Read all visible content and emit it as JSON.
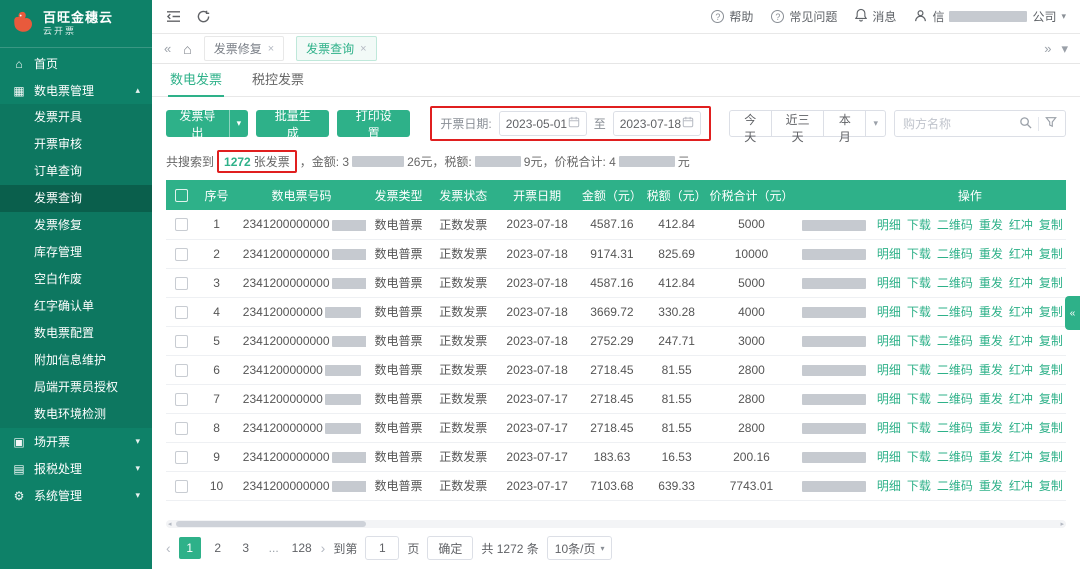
{
  "colors": {
    "sidebar": "#0e8168",
    "accent": "#2eb189",
    "annotation": "#e01f1f"
  },
  "icons": {
    "home": "⌂",
    "close": "×",
    "caret_down": "▾",
    "caret_up": "▴",
    "tabs_left": "«",
    "tabs_right": "»",
    "prev": "‹",
    "next": "›",
    "collapse": "«",
    "scroll_left": "◂",
    "scroll_right": "▸",
    "home-icon": "⌂",
    "invoice-manage-icon": "▦",
    "scene-invoice-icon": "▣",
    "tax-report-icon": "▤",
    "system-manage-icon": "⚙"
  },
  "brand": {
    "title": "百旺金穗云",
    "subtitle": "云开票"
  },
  "topbar": {
    "help": "帮助",
    "faq": "常见问题",
    "messages": "消息",
    "account_prefix": "信",
    "account_suffix": "公司"
  },
  "tabbar": {
    "tabs": [
      {
        "label": "发票修复",
        "active": false
      },
      {
        "label": "发票查询",
        "active": true
      }
    ]
  },
  "sidebar": {
    "items": [
      {
        "label": "首页",
        "icon": "home-icon",
        "children": null,
        "expanded": false
      },
      {
        "label": "数电票管理",
        "icon": "invoice-manage-icon",
        "expanded": true,
        "children": [
          "发票开具",
          "开票审核",
          "订单查询",
          "发票查询",
          "发票修复",
          "库存管理",
          "空白作废",
          "红字确认单",
          "数电票配置",
          "附加信息维护",
          "局端开票员授权",
          "数电环境检测"
        ]
      },
      {
        "label": "场开票",
        "icon": "scene-invoice-icon",
        "expanded": false,
        "children": []
      },
      {
        "label": "报税处理",
        "icon": "tax-report-icon",
        "expanded": false,
        "children": []
      },
      {
        "label": "系统管理",
        "icon": "system-manage-icon",
        "expanded": false,
        "children": []
      }
    ],
    "active_item": "发票查询"
  },
  "content": {
    "tabs": [
      {
        "label": "数电发票",
        "active": true
      },
      {
        "label": "税控发票",
        "active": false
      }
    ],
    "toolbar": {
      "export_button": "发票导出",
      "batch_button": "批量生成",
      "print_button": "打印设置",
      "date_label": "开票日期:",
      "date_start": "2023-05-01",
      "date_to": "至",
      "date_end": "2023-07-18",
      "quick_buttons": [
        "今天",
        "近三天",
        "本月"
      ],
      "search_placeholder": "购方名称"
    },
    "summary": {
      "prefix": "共搜索到",
      "count": "1272",
      "count_unit": "张发票",
      "segments": [
        {
          "text": "，金额: 3"
        },
        {
          "redact": 52
        },
        {
          "text": "26元，税额: "
        },
        {
          "redact": 46
        },
        {
          "text": "9元，价税合计: 4"
        },
        {
          "redact": 56
        },
        {
          "text": "元"
        }
      ]
    },
    "table": {
      "headers": [
        "序号",
        "数电票号码",
        "发票类型",
        "发票状态",
        "开票日期",
        "金额（元）",
        "税额（元）",
        "价税合计（元）",
        "",
        "操作"
      ],
      "op_links": [
        "明细",
        "下载",
        "二维码",
        "重发",
        "红冲",
        "复制"
      ],
      "rows": [
        {
          "no": "1",
          "invoice_prefix": "2341200000000",
          "type": "数电普票",
          "status": "正数发票",
          "date": "2023-07-18",
          "amount": "4587.16",
          "tax": "412.84",
          "total": "5000"
        },
        {
          "no": "2",
          "invoice_prefix": "2341200000000",
          "type": "数电普票",
          "status": "正数发票",
          "date": "2023-07-18",
          "amount": "9174.31",
          "tax": "825.69",
          "total": "10000"
        },
        {
          "no": "3",
          "invoice_prefix": "2341200000000",
          "type": "数电普票",
          "status": "正数发票",
          "date": "2023-07-18",
          "amount": "4587.16",
          "tax": "412.84",
          "total": "5000"
        },
        {
          "no": "4",
          "invoice_prefix": "234120000000",
          "type": "数电普票",
          "status": "正数发票",
          "date": "2023-07-18",
          "amount": "3669.72",
          "tax": "330.28",
          "total": "4000"
        },
        {
          "no": "5",
          "invoice_prefix": "2341200000000",
          "type": "数电普票",
          "status": "正数发票",
          "date": "2023-07-18",
          "amount": "2752.29",
          "tax": "247.71",
          "total": "3000"
        },
        {
          "no": "6",
          "invoice_prefix": "234120000000",
          "type": "数电普票",
          "status": "正数发票",
          "date": "2023-07-18",
          "amount": "2718.45",
          "tax": "81.55",
          "total": "2800"
        },
        {
          "no": "7",
          "invoice_prefix": "234120000000",
          "type": "数电普票",
          "status": "正数发票",
          "date": "2023-07-17",
          "amount": "2718.45",
          "tax": "81.55",
          "total": "2800"
        },
        {
          "no": "8",
          "invoice_prefix": "234120000000",
          "type": "数电普票",
          "status": "正数发票",
          "date": "2023-07-17",
          "amount": "2718.45",
          "tax": "81.55",
          "total": "2800"
        },
        {
          "no": "9",
          "invoice_prefix": "2341200000000",
          "type": "数电普票",
          "status": "正数发票",
          "date": "2023-07-17",
          "amount": "183.63",
          "tax": "16.53",
          "total": "200.16"
        },
        {
          "no": "10",
          "invoice_prefix": "2341200000000",
          "type": "数电普票",
          "status": "正数发票",
          "date": "2023-07-17",
          "amount": "7103.68",
          "tax": "639.33",
          "total": "7743.01"
        }
      ]
    },
    "pagination": {
      "pages": [
        "1",
        "2",
        "3",
        "...",
        "128"
      ],
      "active_page": "1",
      "goto_label": "到第",
      "goto_value": "1",
      "goto_unit": "页",
      "confirm_button": "确定",
      "total_text": "共 1272 条",
      "per_page": "10条/页"
    }
  }
}
